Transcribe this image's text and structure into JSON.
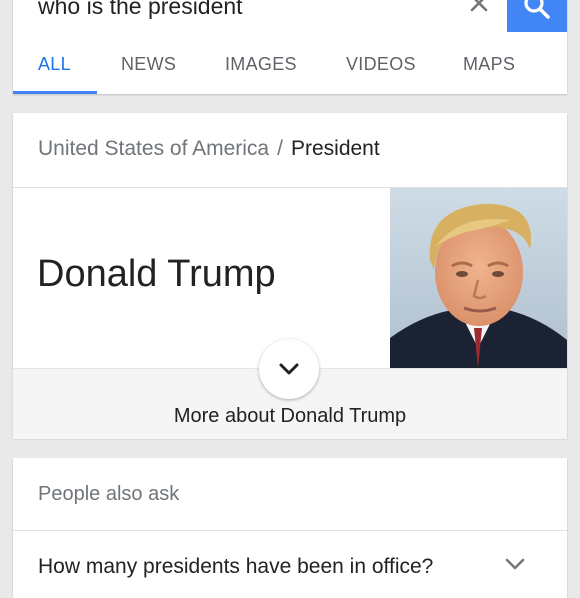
{
  "search": {
    "query": "who is the president"
  },
  "tabs": [
    {
      "label": "ALL",
      "active": true
    },
    {
      "label": "NEWS",
      "active": false
    },
    {
      "label": "IMAGES",
      "active": false
    },
    {
      "label": "VIDEOS",
      "active": false
    },
    {
      "label": "MAPS",
      "active": false
    }
  ],
  "knowledge_panel": {
    "breadcrumb_country": "United States of America",
    "breadcrumb_separator": "/",
    "breadcrumb_role": "President",
    "entity_name": "Donald Trump",
    "more_link": "More about Donald Trump"
  },
  "people_also_ask": {
    "title": "People also ask",
    "questions": [
      "How many presidents have been in office?"
    ]
  },
  "colors": {
    "accent": "#4285f4",
    "page_background": "#e9e9e9",
    "card_background": "#ffffff"
  },
  "icons": {
    "clear": "close-icon",
    "search": "search-icon",
    "expand": "chevron-down-icon"
  }
}
